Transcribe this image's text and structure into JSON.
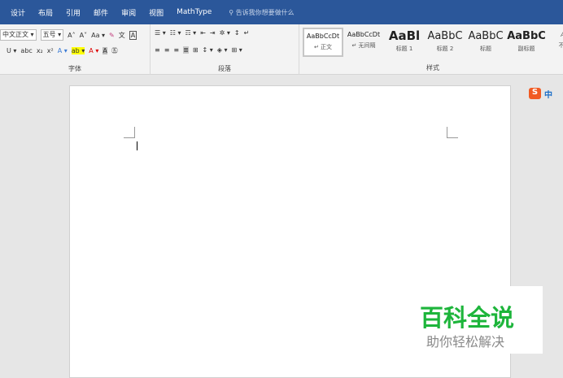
{
  "tabs": [
    "设计",
    "布局",
    "引用",
    "邮件",
    "审阅",
    "视图",
    "MathType"
  ],
  "search": "告诉我你想要做什么",
  "font": {
    "name": "中文正文",
    "size": "五号",
    "label": "字体",
    "row1": [
      "A˄",
      "A˅",
      "Aa ▾",
      "✎",
      "文",
      "A"
    ],
    "row2": [
      "U ▾",
      "abc",
      "x₂",
      "x²",
      "A ▾",
      "ab ▾",
      "A ▾",
      "A",
      "㊄"
    ]
  },
  "paragraph": {
    "label": "段落",
    "row1": [
      "☰ ▾",
      "☷ ▾",
      "☶ ▾",
      "⇤",
      "⇥",
      "✲ ▾",
      "↕",
      "↵"
    ],
    "row2": [
      "≡",
      "≡",
      "≡",
      "≣",
      "⊞",
      "↕ ▾",
      "◈ ▾",
      "⊞ ▾"
    ]
  },
  "styles": {
    "label": "样式",
    "items": [
      {
        "preview": "AaBbCcDt",
        "name": "↵ 正文"
      },
      {
        "preview": "AaBbCcDt",
        "name": "↵ 无间隔"
      },
      {
        "preview": "AaBl",
        "name": "标题 1"
      },
      {
        "preview": "AaBbC",
        "name": "标题 2"
      },
      {
        "preview": "AaBbC",
        "name": "标题"
      },
      {
        "preview": "AaBbC",
        "name": "副标题"
      },
      {
        "preview": "AaB",
        "name": "不明显"
      }
    ]
  },
  "ime": {
    "logo": "S",
    "mode": "中"
  },
  "watermark": {
    "title": "百科全说",
    "subtitle": "助你轻松解决"
  }
}
